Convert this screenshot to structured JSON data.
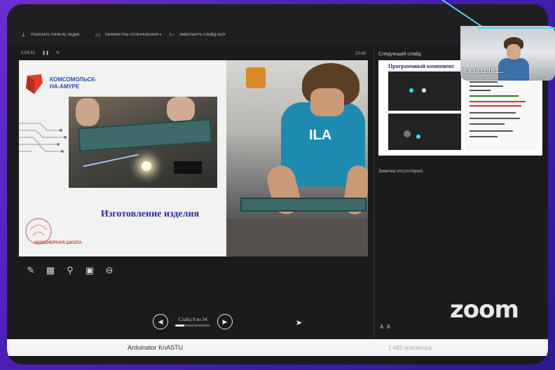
{
  "toolbar": {
    "items": [
      {
        "label": "Показать панель задач",
        "icon": "taskbar-icon"
      },
      {
        "label": "Параметры отображения ▾",
        "icon": "display-icon"
      },
      {
        "label": "Завершить слайд-шоу",
        "icon": "end-show-icon"
      }
    ]
  },
  "presenter": {
    "elapsed_time": "0:04:51",
    "clock_time": "15:42",
    "next_slide_label": "Следующий слайд",
    "notes_text": "Заметки отсутствуют.",
    "slide_counter": "Слайд 9 из 34",
    "slide_progress": 0.26
  },
  "current_slide": {
    "logo_text_line1": "КОМСОМОЛЬСК-",
    "logo_text_line2": "НА-АМУРЕ",
    "caption": "Изготовление изделия",
    "shirt_text": "ILA",
    "school_logo_text": "ИНЖЕНЕРНАЯ ШКОЛА"
  },
  "next_slide": {
    "title": "Программный компонент"
  },
  "webcam": {
    "participant_name": "8,9,10,11,15,1..."
  },
  "branding": {
    "logo": "zoom"
  },
  "footer": {
    "channel": "Arduinator KnASTU",
    "views": "2 482 просмотра"
  },
  "icons": {
    "pen": "pen-icon",
    "layout": "layout-icon",
    "zoom": "magnifier-icon",
    "screen": "screen-icon",
    "more": "more-icon",
    "prev": "prev-icon",
    "next": "next-icon"
  },
  "colors": {
    "background": "#5a28c8",
    "accent_cyan": "#4fd6e8",
    "slide_title_blue": "#2a4fb5",
    "logo_red": "#e53c2a"
  }
}
